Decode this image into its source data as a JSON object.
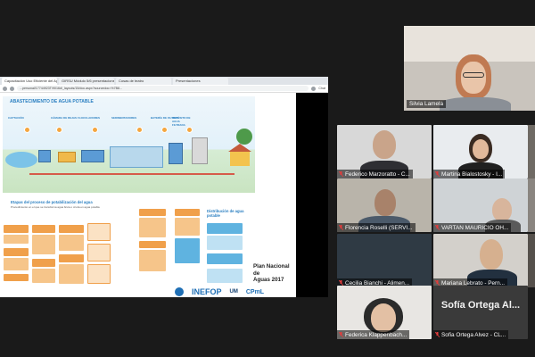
{
  "browser": {
    "tabs": [
      {
        "label": "Capacitación Uso Eficiente del Agu..."
      },
      {
        "label": "GIRSU Módulo 5/6 presentaciones..."
      },
      {
        "label": "Cosas de teatro"
      },
      {
        "label": "Presentaciones"
      }
    ],
    "url": "...personal/17744923T/9016d/_layouts/15/doc.aspx?sourcedoc=%7B8...",
    "chat_label": "Chat"
  },
  "slide": {
    "title": "ABASTECIMIENTO DE AGUA POTABLE",
    "stages": [
      "CAPTACIÓN",
      "CÁMARA DE REJAS",
      "FLOCULADORES",
      "SEDIMENTADORES",
      "BATERÍA DE FILTROS",
      "DEPÓSITO DE AGUA FILTRADA"
    ],
    "left_section_title": "Etapas del proceso de potabilización del agua",
    "left_section_sub": "Procedimiento en el que se transforma agua bruta o cruda en agua potable",
    "right_section_title": "Distribución de agua potable",
    "plan_line1": "Plan Nacional",
    "plan_line2": "de",
    "plan_line3": "Aguas 2017",
    "logos": {
      "inefop": "INEFOP",
      "um": "UM",
      "cpml": "CPmL"
    }
  },
  "participants": {
    "speaker": {
      "name": "Silvia Lamela"
    },
    "tiles": [
      {
        "name": "Federico Marzoratto - C..."
      },
      {
        "name": "Martina Bialostosky - I..."
      },
      {
        "name": "Florencia Roselli (SERVI..."
      },
      {
        "name": "VARTAN MAURICIO OH..."
      },
      {
        "name": "Cecilia Bianchi - Alimen..."
      },
      {
        "name": "Mariana Lebrato - Pern..."
      },
      {
        "name": "Federica Klappenbach..."
      },
      {
        "name": "Sofia Ortega Alvez - CL..."
      }
    ],
    "text_tile_name": "Sofía Ortega Al..."
  }
}
